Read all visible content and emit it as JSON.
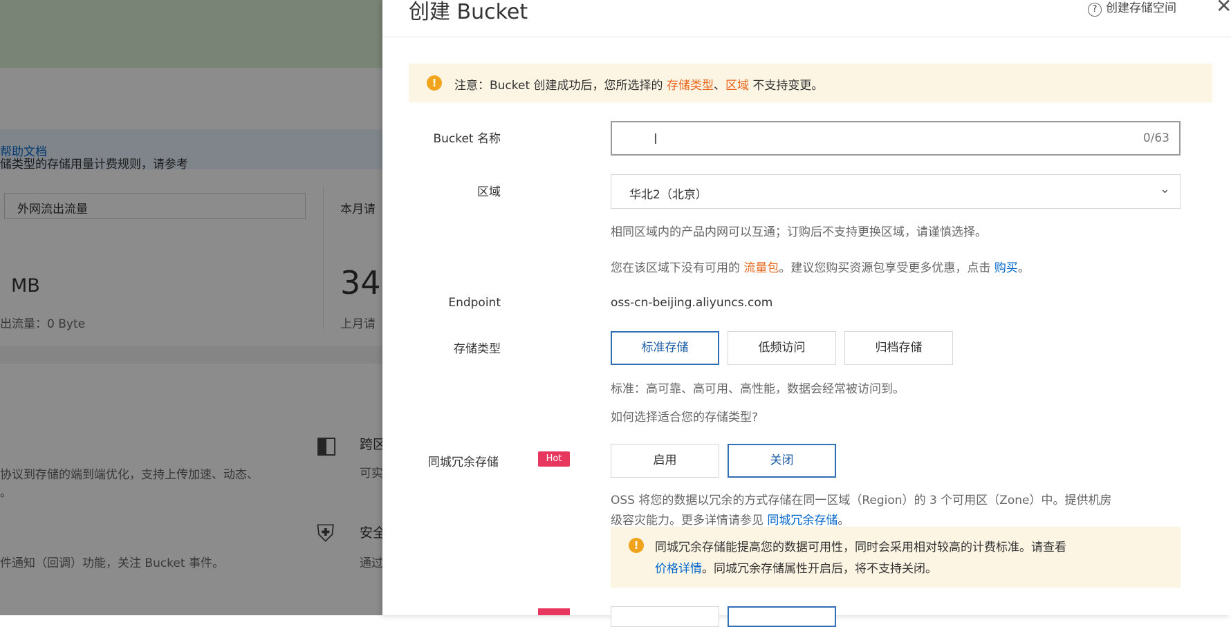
{
  "background": {
    "notice_text": "储类型的存储用量计费规则，请参考",
    "notice_link": "帮助文档",
    "traffic_select": "外网流出流量",
    "month_label": "本月请",
    "mb_label": "MB",
    "big_number": "34",
    "outflow_label": "出流量：0 Byte",
    "last_month_label": "上月请",
    "desc1_line1": "协议到存储的端到端优化，支持上传加速、动态、",
    "desc1_line2": "。",
    "cross_label": "跨区",
    "cross_sub": "可实",
    "event_text": "件通知（回调）功能，关注 Bucket 事件。",
    "security_label": "安全",
    "security_sub": "通过"
  },
  "drawer": {
    "title": "创建 Bucket",
    "help_label": "创建存储空间",
    "warning": {
      "prefix": "注意：Bucket 创建成功后，您所选择的 ",
      "storage_type": "存储类型",
      "sep": "、",
      "region": "区域",
      "suffix": " 不支持变更。"
    },
    "bucket_name": {
      "label": "Bucket 名称",
      "value": "",
      "count": "0/63"
    },
    "region": {
      "label": "区域",
      "value": "华北2（北京）",
      "note1": "相同区域内的产品内网可以互通；订购后不支持更换区域，请谨慎选择。",
      "note2_prefix": "您在该区域下没有可用的 ",
      "note2_link1": "流量包",
      "note2_mid": "。建议您购买资源包享受更多优惠，点击 ",
      "note2_link2": "购买",
      "note2_suffix": "。"
    },
    "endpoint": {
      "label": "Endpoint",
      "value": "oss-cn-beijing.aliyuncs.com"
    },
    "storage_class": {
      "label": "存储类型",
      "options": [
        "标准存储",
        "低频访问",
        "归档存储"
      ],
      "selected": "标准存储",
      "note": "标准：高可靠、高可用、高性能，数据会经常被访问到。",
      "link": "如何选择适合您的存储类型?"
    },
    "redundancy": {
      "label": "同城冗余存储",
      "badge": "Hot",
      "options": [
        "启用",
        "关闭"
      ],
      "selected": "关闭",
      "note_line1": "OSS 将您的数据以冗余的方式存储在同一区域（Region）的 3 个可用区（Zone）中。提供机房",
      "note_line2_prefix": "级容灾能力。更多详情请参见 ",
      "note_line2_link": "同城冗余存储",
      "note_line2_suffix": "。",
      "warn_line1": "同城冗余存储能提高您的数据可用性，同时会采用相对较高的计费标准。请查看",
      "warn_line2_link": "价格详情",
      "warn_line2_suffix": "。同城冗余存储属性开启后，将不支持关闭。"
    }
  }
}
